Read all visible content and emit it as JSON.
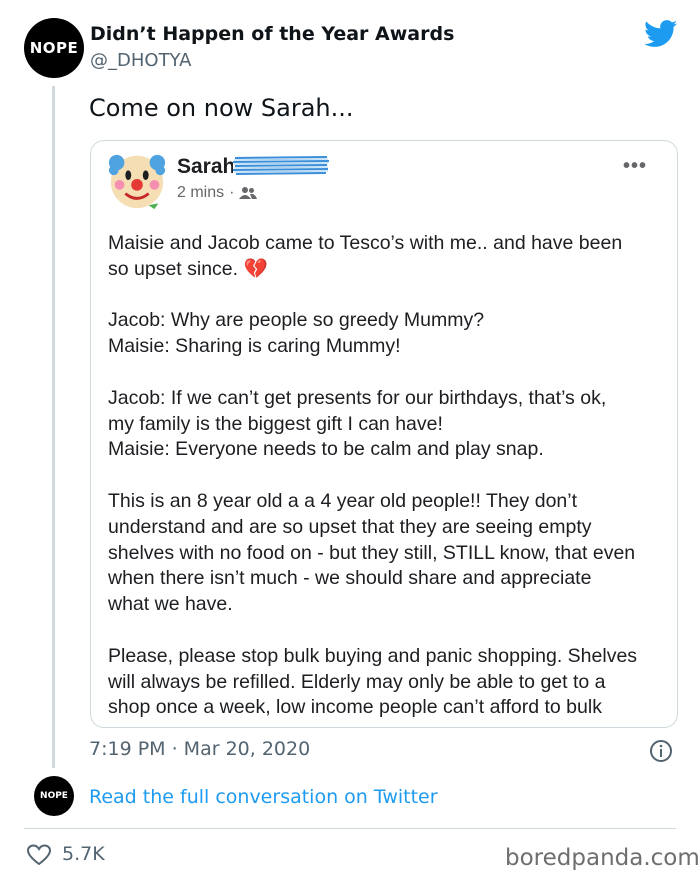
{
  "tweet": {
    "avatar_text": "NOPE",
    "author_name": "Didn’t Happen of the Year Awards",
    "author_handle": "@_DHOTYA",
    "text": "Come on now Sarah...",
    "timestamp": "7:19 PM · Mar 20, 2020",
    "read_more": "Read the full conversation on Twitter",
    "likes": "5.7K",
    "twitter_blue": "#1d9bf0"
  },
  "facebook_post": {
    "name": "Sarah",
    "time": "2 mins",
    "meta_separator": "·",
    "audience_icon": "friends-icon",
    "paragraphs": [
      [
        "Maisie and Jacob came to Tesco’s with me.. and have been",
        "so upset since. 💔"
      ],
      [
        "Jacob: Why are people so greedy Mummy?",
        "Maisie: Sharing is caring Mummy!"
      ],
      [
        "Jacob: If we can’t get presents for our birthdays, that’s ok,",
        "my family is the biggest gift I can have!",
        "Maisie: Everyone needs to be calm and play snap."
      ],
      [
        "This is an 8 year old a a 4 year old people!! They don’t",
        "understand and are so upset that they are seeing empty",
        "shelves with no food on - but they still, STILL know, that even",
        "when there isn’t much - we should share and appreciate",
        "what we have."
      ],
      [
        "Please, please stop bulk buying and panic shopping. Shelves",
        "will always be refilled. Elderly may only be able to get to a",
        "shop once a week, low income people can’t afford to bulk"
      ]
    ]
  },
  "footer": {
    "watermark": "boredpanda.com"
  }
}
